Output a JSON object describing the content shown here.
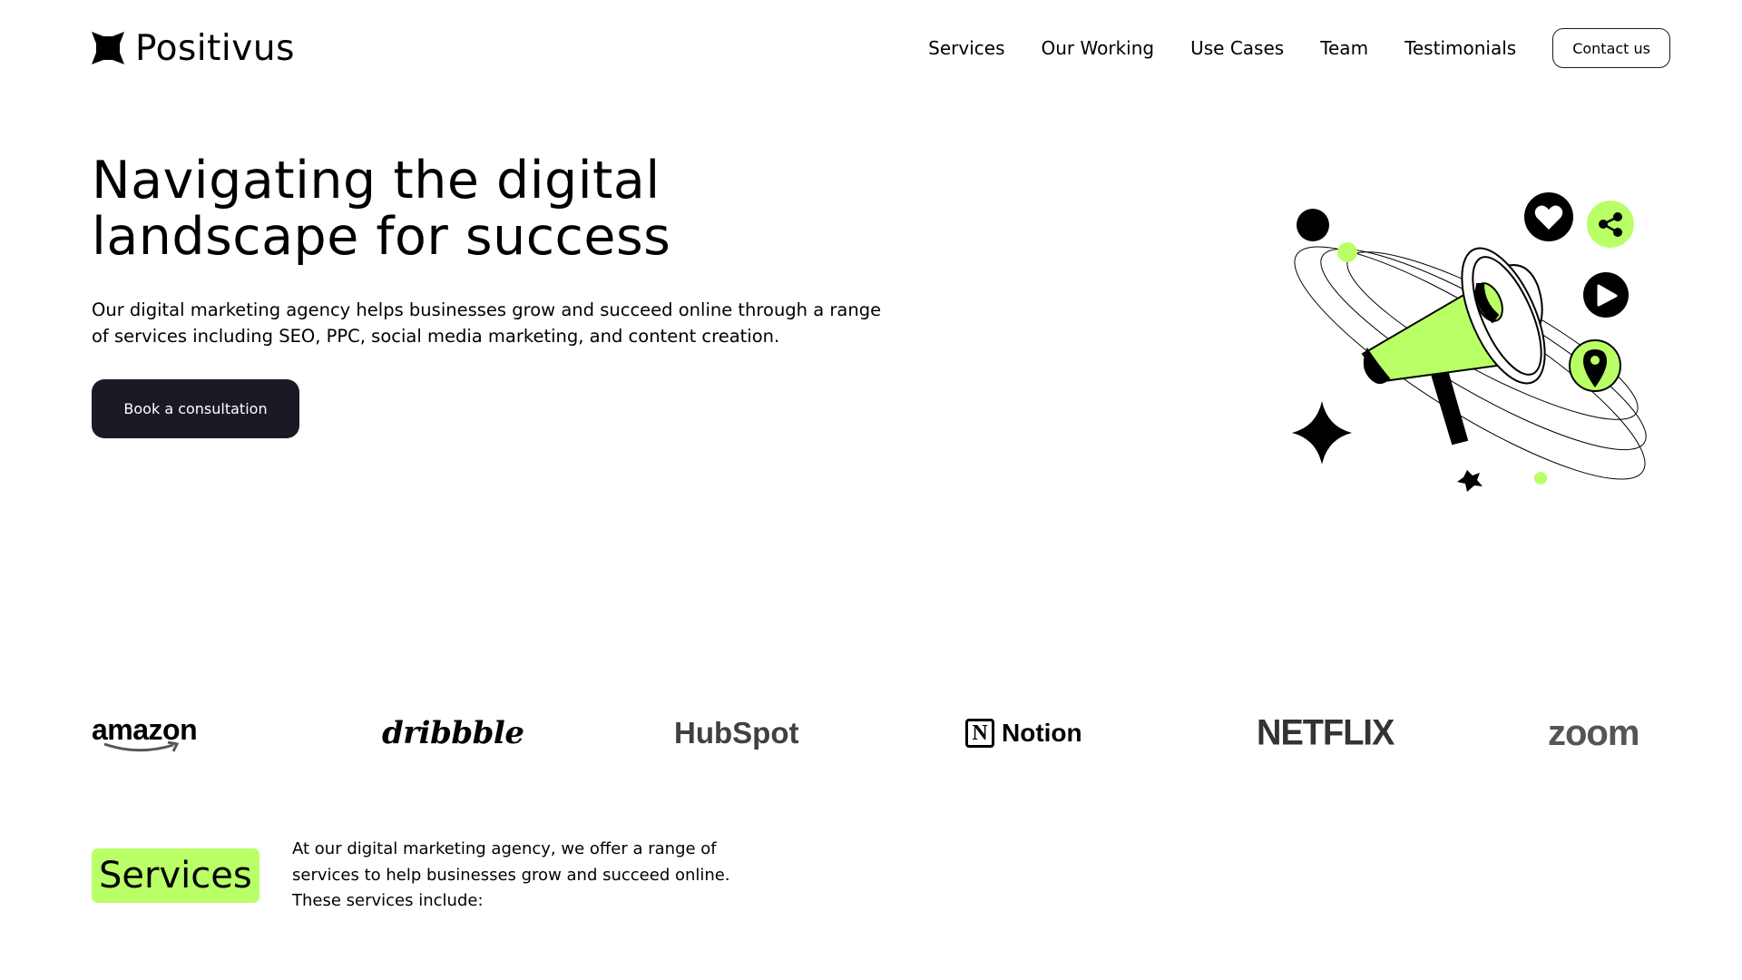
{
  "header": {
    "logo_text": "Positivus",
    "nav": [
      "Services",
      "Our Working",
      "Use Cases",
      "Team",
      "Testimonials"
    ],
    "contact_label": "Contact us"
  },
  "hero": {
    "title_line1": "Navigating the digital",
    "title_line2": "landscape for success",
    "description": "Our digital marketing agency helps businesses grow and succeed online through a range of services including SEO, PPC, social media marketing, and content creation.",
    "cta_label": "Book a consultation",
    "illustration_icons": [
      "heart-icon",
      "share-icon",
      "play-icon",
      "location-pin-icon",
      "megaphone-icon",
      "sparkle-icon"
    ]
  },
  "brands": {
    "amazon": "amazon",
    "dribbble": "dribbble",
    "hubspot": "HubSpot",
    "notion": "Notion",
    "notion_mark": "N",
    "netflix": "NETFLIX",
    "zoom": "zoom"
  },
  "services": {
    "heading": "Services",
    "description": "At our digital marketing agency, we offer a range of services to help businesses grow and succeed online. These services include:"
  },
  "colors": {
    "accent": "#B9FF66",
    "dark": "#191A23",
    "text": "#000000",
    "background": "#FFFFFF"
  }
}
